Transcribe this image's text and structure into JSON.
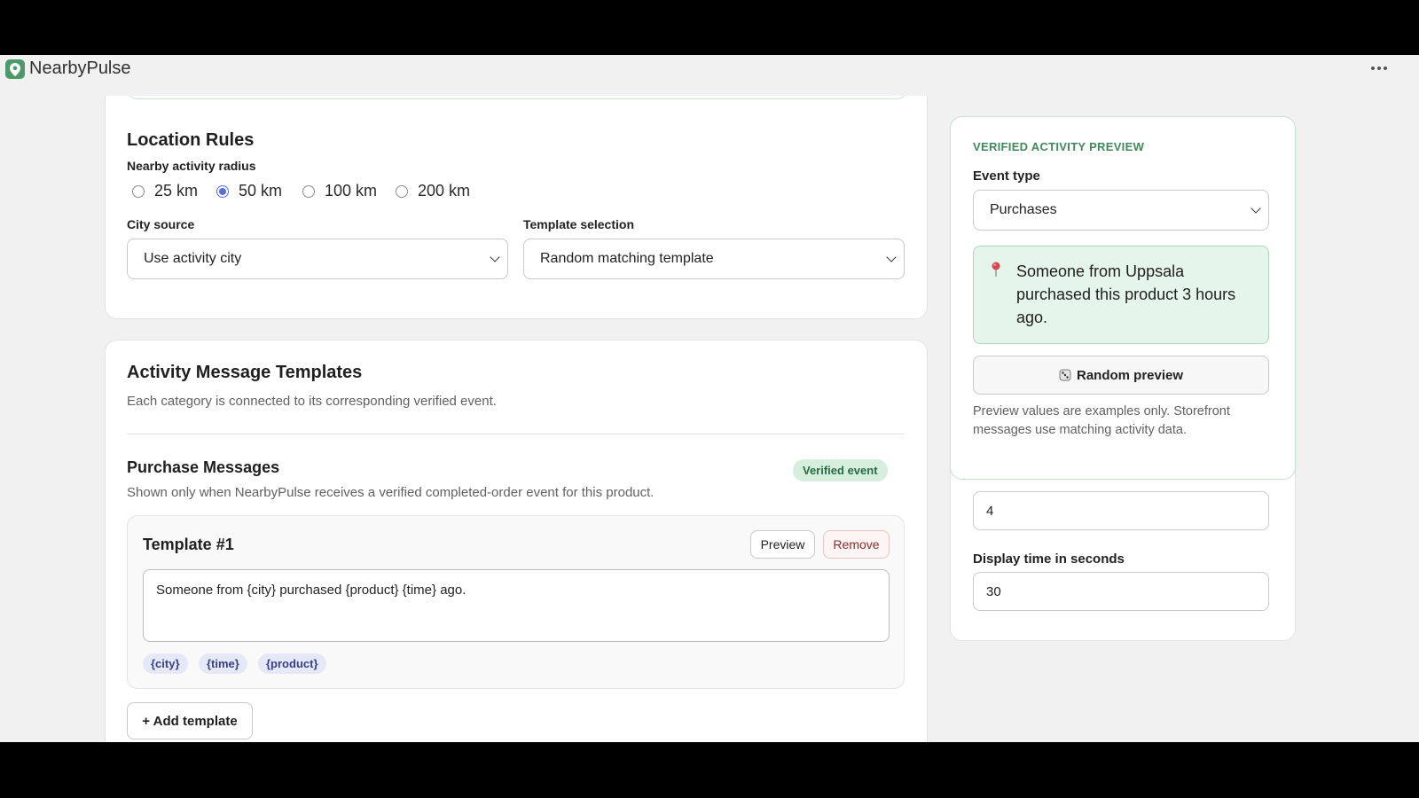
{
  "app": {
    "name": "NearbyPulse",
    "icon": "map-pin-icon",
    "brand_color": "#4c9a6a"
  },
  "header": {
    "more_icon": "more-horizontal-icon"
  },
  "location_rules": {
    "title": "Location Rules",
    "radius_label": "Nearby activity radius",
    "radius_options": [
      "25 km",
      "50 km",
      "100 km",
      "200 km"
    ],
    "radius_selected": "50 km",
    "city_source_label": "City source",
    "city_source_value": "Use activity city",
    "template_selection_label": "Template selection",
    "template_selection_value": "Random matching template"
  },
  "templates_section": {
    "title": "Activity Message Templates",
    "subtitle": "Each category is connected to its corresponding verified event.",
    "purchase": {
      "title": "Purchase Messages",
      "badge": "Verified event",
      "description": "Shown only when NearbyPulse receives a verified completed-order event for this product.",
      "template": {
        "title": "Template #1",
        "preview_label": "Preview",
        "remove_label": "Remove",
        "text": "Someone from {city} purchased {product} {time} ago.",
        "chips": [
          "{city}",
          "{time}",
          "{product}"
        ]
      },
      "add_label": "+ Add template"
    }
  },
  "preview": {
    "eyebrow": "VERIFIED ACTIVITY PREVIEW",
    "event_type_label": "Event type",
    "event_type_value": "Purchases",
    "pin_icon": "pushpin-icon",
    "message": "Someone from Uppsala purchased this product 3 hours ago.",
    "random_icon": "dice-icon",
    "random_label": "Random preview",
    "note": "Preview values are examples only. Storefront messages use matching activity data.",
    "accent_color": "#3f8a5c"
  },
  "settings": {
    "field_value": "4",
    "display_time_label": "Display time in seconds",
    "display_time_value": "30"
  }
}
